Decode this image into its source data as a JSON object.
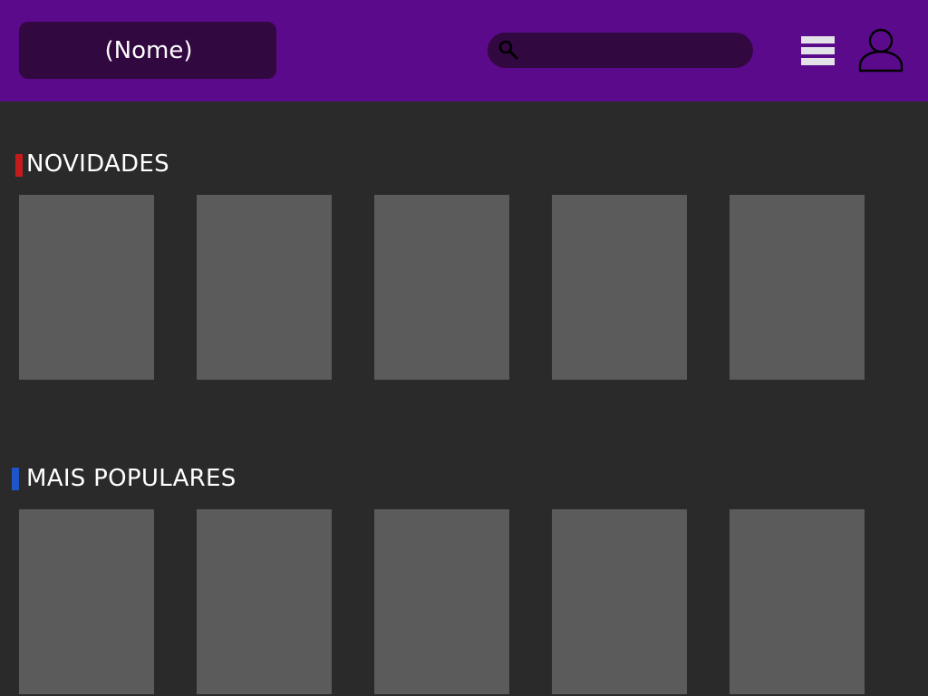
{
  "header": {
    "brand_label": "(Nome)",
    "search_placeholder": "",
    "icons": [
      "search-icon",
      "menu-icon",
      "profile-icon"
    ]
  },
  "colors": {
    "header_bg": "#5b0a8b",
    "header_dark": "#320840",
    "page_bg": "#2a2a2a",
    "card_bg": "#5b5b5b",
    "novidades_marker": "#c41c1c",
    "populares_marker": "#1f55c8"
  },
  "sections": [
    {
      "title": "NOVIDADES",
      "marker_color": "#c41c1c",
      "card_count": 5
    },
    {
      "title": "MAIS POPULARES",
      "marker_color": "#1f55c8",
      "card_count": 5
    }
  ]
}
